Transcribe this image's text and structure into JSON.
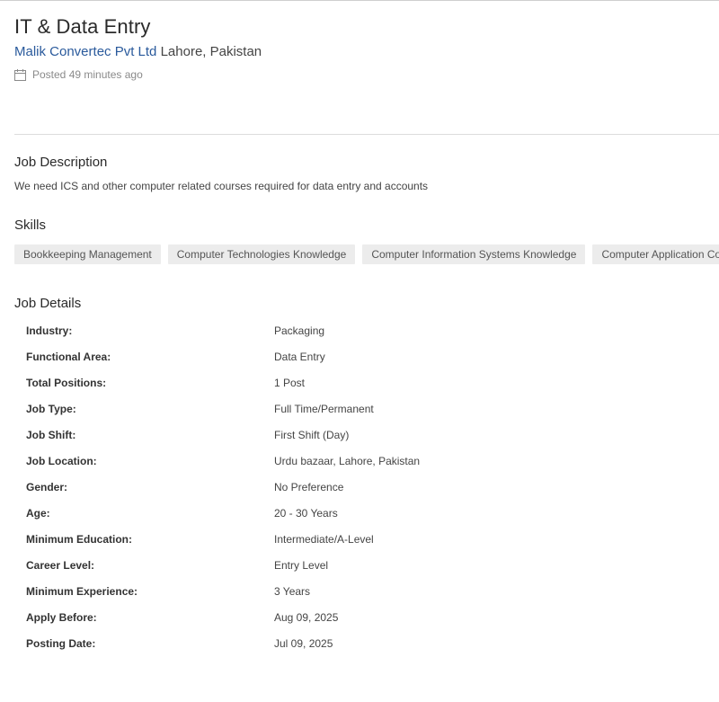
{
  "job": {
    "title": "IT & Data Entry",
    "company": "Malik Convertec Pvt Ltd",
    "location": "Lahore, Pakistan",
    "posted": "Posted 49 minutes ago"
  },
  "description": {
    "heading": "Job Description",
    "text": "We need ICS and other computer related courses required for data entry and accounts"
  },
  "skills": {
    "heading": "Skills",
    "items": [
      "Bookkeeping Management",
      "Computer Technologies Knowledge",
      "Computer Information Systems Knowledge",
      "Computer Application Command"
    ]
  },
  "details": {
    "heading": "Job Details",
    "rows": [
      {
        "label": "Industry:",
        "value": "Packaging"
      },
      {
        "label": "Functional Area:",
        "value": "Data Entry"
      },
      {
        "label": "Total Positions:",
        "value": "1 Post"
      },
      {
        "label": "Job Type:",
        "value": "Full Time/Permanent"
      },
      {
        "label": "Job Shift:",
        "value": "First Shift (Day)"
      },
      {
        "label": "Job Location:",
        "value": "Urdu bazaar, Lahore, Pakistan"
      },
      {
        "label": "Gender:",
        "value": "No Preference"
      },
      {
        "label": "Age:",
        "value": "20 - 30 Years"
      },
      {
        "label": "Minimum Education:",
        "value": "Intermediate/A-Level"
      },
      {
        "label": "Career Level:",
        "value": "Entry Level"
      },
      {
        "label": "Minimum Experience:",
        "value": "3 Years"
      },
      {
        "label": "Apply Before:",
        "value": "Aug 09, 2025"
      },
      {
        "label": "Posting Date:",
        "value": "Jul 09, 2025"
      }
    ]
  },
  "icons": {
    "posted": "calendar-icon"
  },
  "colors": {
    "company_link": "#2a5a9c",
    "chip_background": "#ececec",
    "divider": "#dcdcdc"
  }
}
